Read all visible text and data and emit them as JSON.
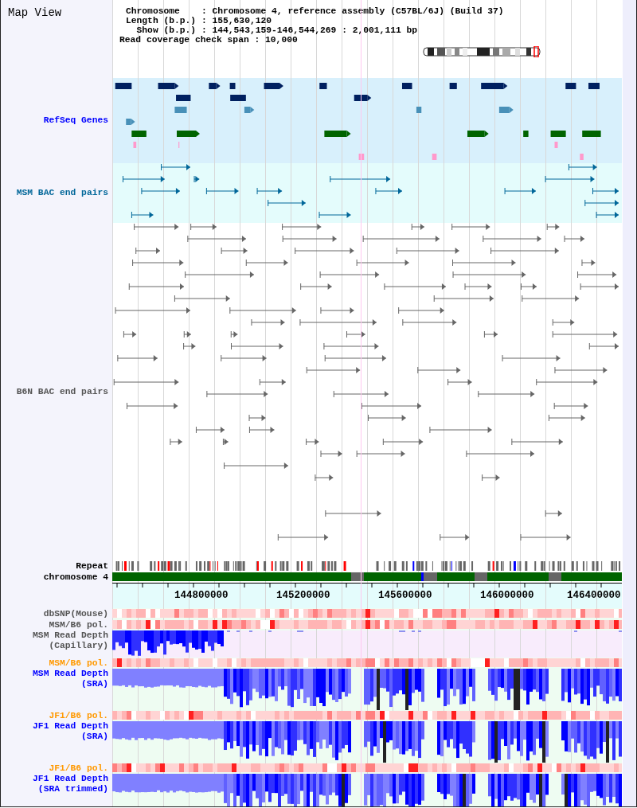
{
  "panel_title": "Map View",
  "info_lines": [
    "Chromosome    : Chromosome 4, reference assembly (C57BL/6J) (Build 37)",
    "Length (b.p.) : 155,630,120",
    "  Show (b.p.) : 144,543,159-146,544,269 : 2,001,111 bp",
    "Read coverage check span : 10,000"
  ],
  "tracks": [
    {
      "kind": "genes",
      "label": [
        "RefSeq Genes"
      ],
      "color": "#0000ff"
    },
    {
      "kind": "bac-msm",
      "label": [
        "MSM BAC end pairs"
      ],
      "color": "#006699"
    },
    {
      "kind": "bac-b6n",
      "label": [
        "B6N BAC end pairs"
      ],
      "color": "#555555"
    },
    {
      "kind": "repeat",
      "label": [
        "Repeat"
      ],
      "color": "#000000"
    },
    {
      "kind": "chromosome",
      "label": [
        "chromosome 4"
      ],
      "color": "#000000"
    },
    {
      "kind": "axis",
      "ticks": [
        "144800000",
        "145200000",
        "145600000",
        "146000000",
        "146400000"
      ]
    },
    {
      "kind": "snp",
      "label": [
        "dbSNP(Mouse)"
      ],
      "color": "#555555"
    },
    {
      "kind": "snp",
      "label": [
        "MSM/B6 pol."
      ],
      "color": "#555555"
    },
    {
      "kind": "depth-capillary",
      "label": [
        "MSM Read Depth",
        "(Capillary)"
      ],
      "color": "#555555"
    },
    {
      "kind": "snp",
      "label": [
        "MSM/B6 pol."
      ],
      "color": "#ff9900"
    },
    {
      "kind": "depth-sra",
      "label": [
        "MSM Read Depth",
        "(SRA)"
      ],
      "color": "#0000ff"
    },
    {
      "kind": "snp",
      "label": [
        "JF1/B6 pol."
      ],
      "color": "#ff9900"
    },
    {
      "kind": "depth-sra",
      "label": [
        "JF1 Read Depth",
        "(SRA)"
      ],
      "color": "#0000ff"
    },
    {
      "kind": "snp",
      "label": [
        "JF1/B6 pol."
      ],
      "color": "#ff9900"
    },
    {
      "kind": "depth-sra",
      "label": [
        "JF1 Read Depth",
        "(SRA trimmed)"
      ],
      "color": "#0000ff"
    }
  ]
}
